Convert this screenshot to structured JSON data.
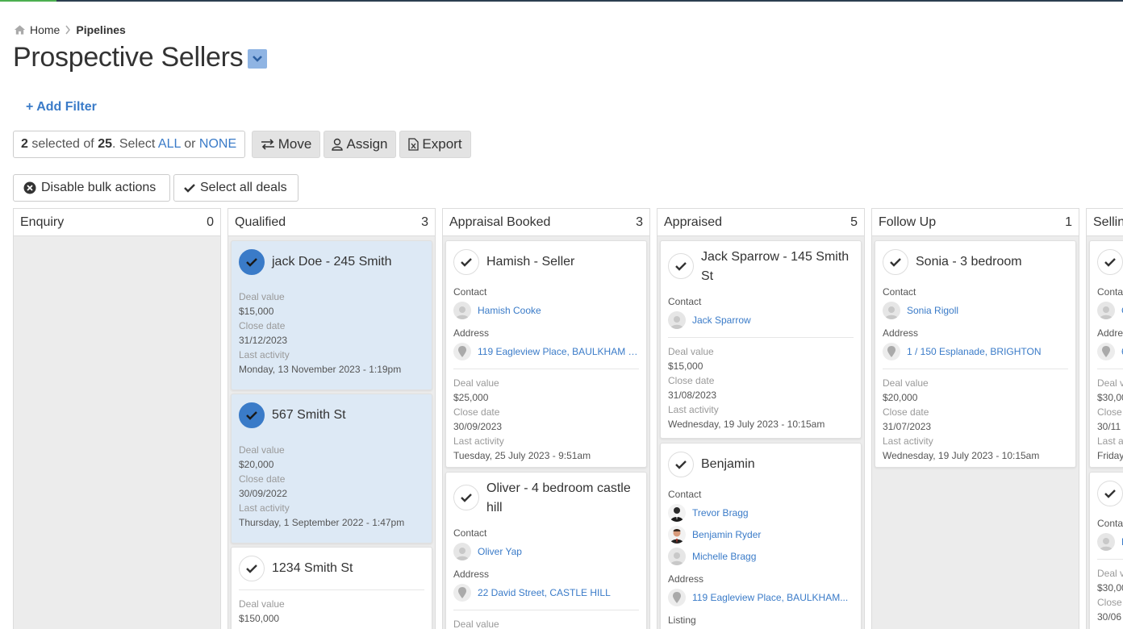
{
  "breadcrumb": {
    "home": "Home",
    "current": "Pipelines"
  },
  "page": {
    "title": "Prospective Sellers"
  },
  "filter": {
    "add_label": "Add Filter"
  },
  "selection": {
    "count": "2",
    "pre": " selected of ",
    "total": "25",
    "mid": ". Select ",
    "all": "ALL",
    "or": " or ",
    "none": "NONE"
  },
  "toolbar": {
    "move": "Move",
    "assign": "Assign",
    "export": "Export"
  },
  "bulk": {
    "disable": "Disable bulk actions",
    "select_all": "Select all deals"
  },
  "labels": {
    "contact": "Contact",
    "address": "Address",
    "deal_value": "Deal value",
    "close_date": "Close date",
    "last_activity": "Last activity",
    "listing": "Listing"
  },
  "columns": [
    {
      "name": "Enquiry",
      "count": "0"
    },
    {
      "name": "Qualified",
      "count": "3"
    },
    {
      "name": "Appraisal Booked",
      "count": "3"
    },
    {
      "name": "Appraised",
      "count": "5"
    },
    {
      "name": "Follow Up",
      "count": "1"
    },
    {
      "name": "Sellin",
      "count": ""
    }
  ],
  "cards": {
    "q1": {
      "title": "jack Doe - 245 Smith",
      "deal_value": "$15,000",
      "close_date": "31/12/2023",
      "last_activity": "Monday, 13 November 2023 - 1:19pm"
    },
    "q2": {
      "title": "567 Smith St",
      "deal_value": "$20,000",
      "close_date": "30/09/2022",
      "last_activity": "Thursday, 1 September 2022 - 1:47pm"
    },
    "q3": {
      "title": "1234 Smith St",
      "deal_value": "$150,000"
    },
    "ab1": {
      "title": "Hamish - Seller",
      "contact": "Hamish Cooke",
      "address": "119 Eagleview Place, BAULKHAM H...",
      "deal_value": "$25,000",
      "close_date": "30/09/2023",
      "last_activity": "Tuesday, 25 July 2023 - 9:51am"
    },
    "ab2": {
      "title": "Oliver - 4 bedroom castle hill",
      "contact": "Oliver Yap",
      "address": "22 David Street, CASTLE HILL"
    },
    "ap1": {
      "title": "Jack Sparrow - 145 Smith St",
      "contact": "Jack Sparrow",
      "deal_value": "$15,000",
      "close_date": "31/08/2023",
      "last_activity": "Wednesday, 19 July 2023 - 10:15am"
    },
    "ap2": {
      "title": "Benjamin",
      "contacts": [
        "Trevor Bragg",
        "Benjamin Ryder",
        "Michelle Bragg"
      ],
      "address": "119 Eagleview Place, BAULKHAM..."
    },
    "fu1": {
      "title": "Sonia - 3 bedroom",
      "contact": "Sonia Rigoll",
      "address": "1 / 150 Esplanade, BRIGHTON",
      "deal_value": "$20,000",
      "close_date": "31/07/2023",
      "last_activity": "Wednesday, 19 July 2023 - 10:15am"
    },
    "s1": {
      "contact_label": "Conta",
      "contact": "C",
      "address_label": "Addre",
      "address": "6",
      "deal_label": "Deal v",
      "deal_value": "$30,00",
      "close_label": "Close",
      "close_date": "30/11",
      "last_label": "Last a",
      "last_activity": "Friday"
    },
    "s2": {
      "contact_label": "Conta",
      "contact": "E",
      "deal_label": "Deal v",
      "deal_value": "$30,00",
      "close_label": "Close",
      "close_date": "30/06"
    }
  },
  "colors": {
    "accent": "#3a7bc8",
    "selected_card": "#dde9f5",
    "column_bg": "#ececec"
  },
  "icons": [
    "home-icon",
    "chevron-right-icon",
    "chevron-down-icon",
    "plus-icon",
    "arrows-icon",
    "user-icon",
    "excel-file-icon",
    "close-circle-icon",
    "check-icon",
    "avatar-icon",
    "map-pin-icon"
  ]
}
